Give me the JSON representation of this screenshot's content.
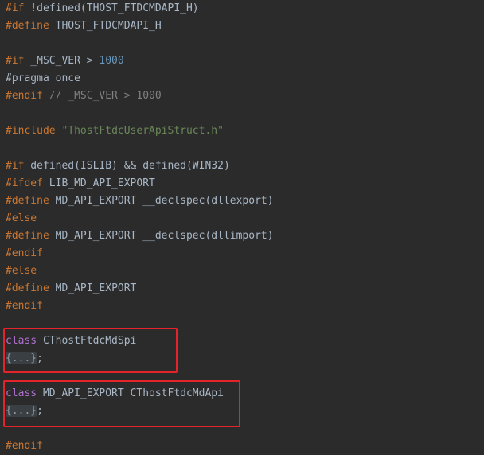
{
  "code": {
    "lines": [
      {
        "directive": "#if",
        "rest": " !defined(THOST_FTDCMDAPI_H)"
      },
      {
        "directive": "#define",
        "rest": " THOST_FTDCMDAPI_H"
      },
      {
        "directive": "#if",
        "rest": " _MSC_VER > ",
        "number": "1000"
      },
      {
        "directive": "#pragma",
        "rest": " once"
      },
      {
        "directive": "#endif",
        "comment": " // _MSC_VER > 1000"
      },
      {
        "directive": "#include",
        "string": " \"ThostFtdcUserApiStruct.h\""
      },
      {
        "directive": "#if",
        "rest": " defined(ISLIB) && defined(WIN32)"
      },
      {
        "directive": "#ifdef",
        "rest": " LIB_MD_API_EXPORT"
      },
      {
        "directive": "#define",
        "rest": " MD_API_EXPORT __declspec(dllexport)"
      },
      {
        "directive": "#else"
      },
      {
        "directive": "#define",
        "rest": " MD_API_EXPORT __declspec(dllimport)"
      },
      {
        "directive": "#endif"
      },
      {
        "directive": "#else"
      },
      {
        "directive": "#define",
        "rest": " MD_API_EXPORT"
      },
      {
        "directive": "#endif"
      },
      {
        "keyword": "class",
        "rest": " CThostFtdcMdSpi"
      },
      {
        "fold": "{...}",
        "punct": ";"
      },
      {
        "keyword": "class",
        "rest": " MD_API_EXPORT CThostFtdcMdApi"
      },
      {
        "fold": "{...}",
        "punct": ";"
      },
      {
        "directive": "#endif"
      }
    ]
  },
  "colors": {
    "background": "#2b2b2b",
    "directive": "#cc7832",
    "text": "#a9b7c6",
    "number": "#6897bb",
    "comment": "#808080",
    "string": "#6a8759",
    "class_keyword": "#b070d0",
    "highlight_border": "#e5232a"
  }
}
